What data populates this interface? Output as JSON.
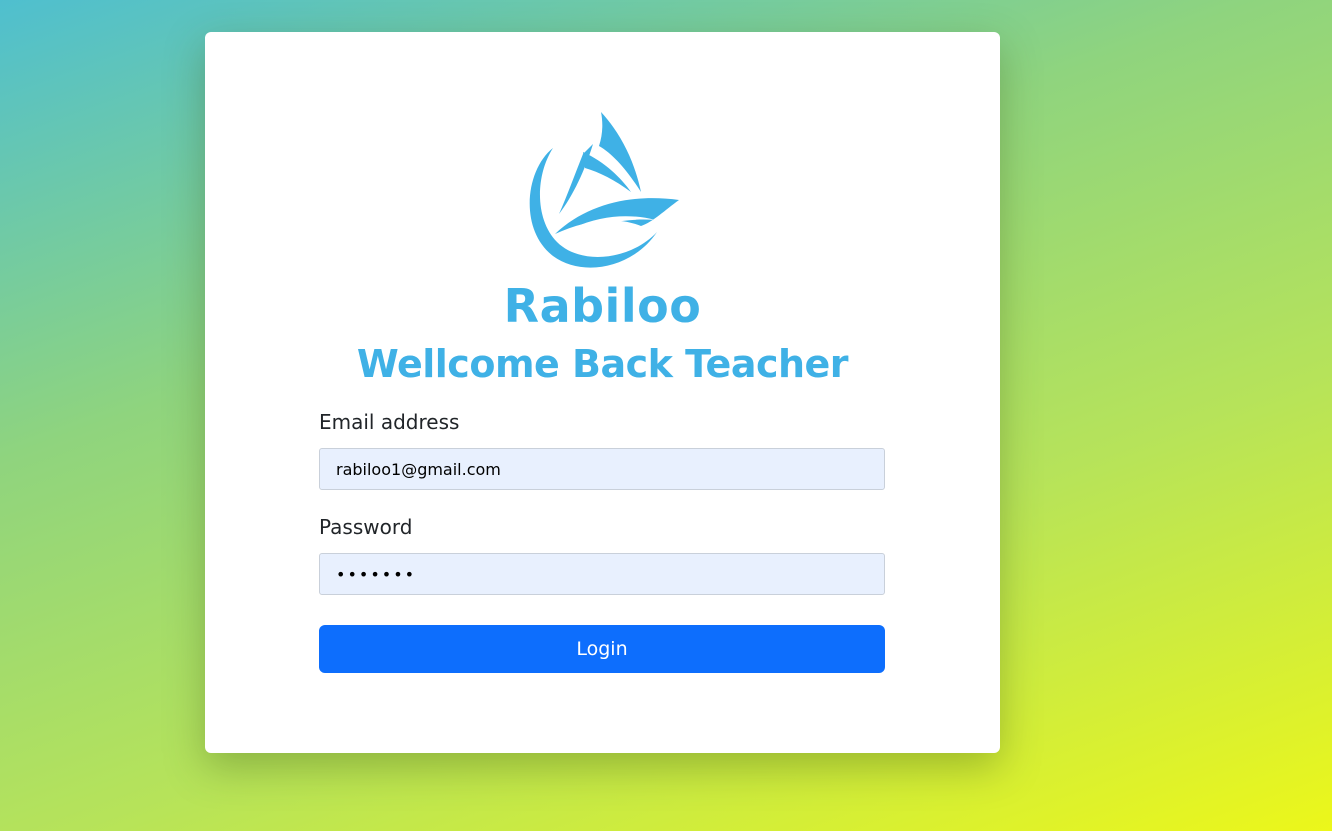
{
  "brand": {
    "name": "Rabiloo",
    "logo_icon": "sailboat-logo-icon",
    "color": "#3fb1e6"
  },
  "form": {
    "heading": "Wellcome Back Teacher",
    "email_label": "Email address",
    "email_value": "rabiloo1@gmail.com",
    "password_label": "Password",
    "password_value": "•••••••",
    "login_label": "Login",
    "button_color": "#0d6efd",
    "input_background": "#e8f0fe"
  }
}
